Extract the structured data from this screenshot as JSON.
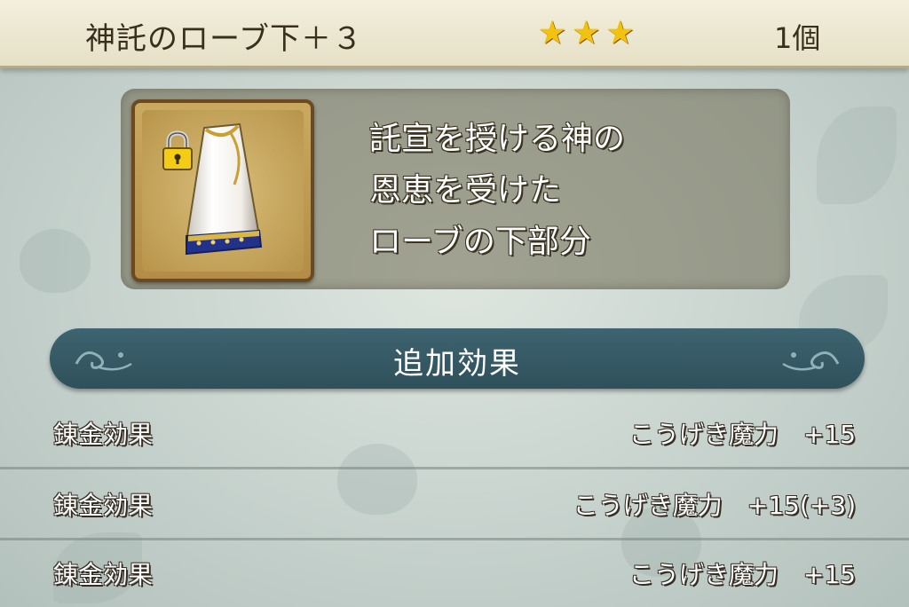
{
  "item": {
    "name": "神託のローブ下＋３",
    "stars": [
      "★",
      "★",
      "★"
    ],
    "count": "1個",
    "icon": "robe-bottom-icon",
    "locked_icon": "padlock-icon"
  },
  "description": {
    "lines": [
      "託宣を授ける神の",
      "恩恵を受けた",
      "ローブの下部分"
    ]
  },
  "section": {
    "title": "追加効果"
  },
  "effects": [
    {
      "label": "錬金効果",
      "value": "こうげき魔力　+15"
    },
    {
      "label": "錬金効果",
      "value": "こうげき魔力　+15(+3)"
    },
    {
      "label": "錬金効果",
      "value": "こうげき魔力　+15"
    }
  ],
  "colors": {
    "header_bg": "#ece7d0",
    "star": "#f2c20f",
    "section_bar": "#365a66",
    "text_outline": "#352c22"
  }
}
